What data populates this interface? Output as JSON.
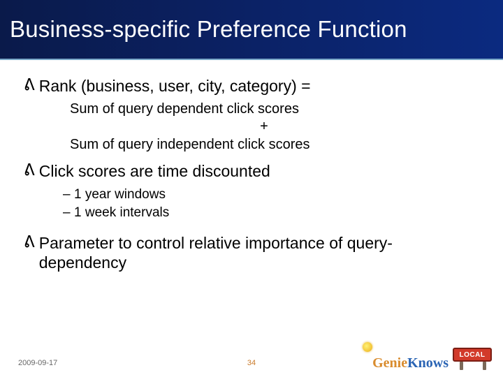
{
  "title": "Business-specific Preference Function",
  "bullets": [
    {
      "text": "Rank (business, user, city, category) =",
      "sub": {
        "line1": "Sum of query dependent click scores",
        "plus": "+",
        "line2": "Sum of query independent click scores"
      }
    },
    {
      "text": "Click scores are time discounted",
      "dashes": [
        "1 year windows",
        "1 week intervals"
      ]
    },
    {
      "text": "Parameter to control relative importance of query-dependency"
    }
  ],
  "footer": {
    "date": "2009-09-17",
    "page": "34"
  },
  "logo": {
    "word1": "Genie",
    "word2": "Knows",
    "sign": "LOCAL"
  }
}
